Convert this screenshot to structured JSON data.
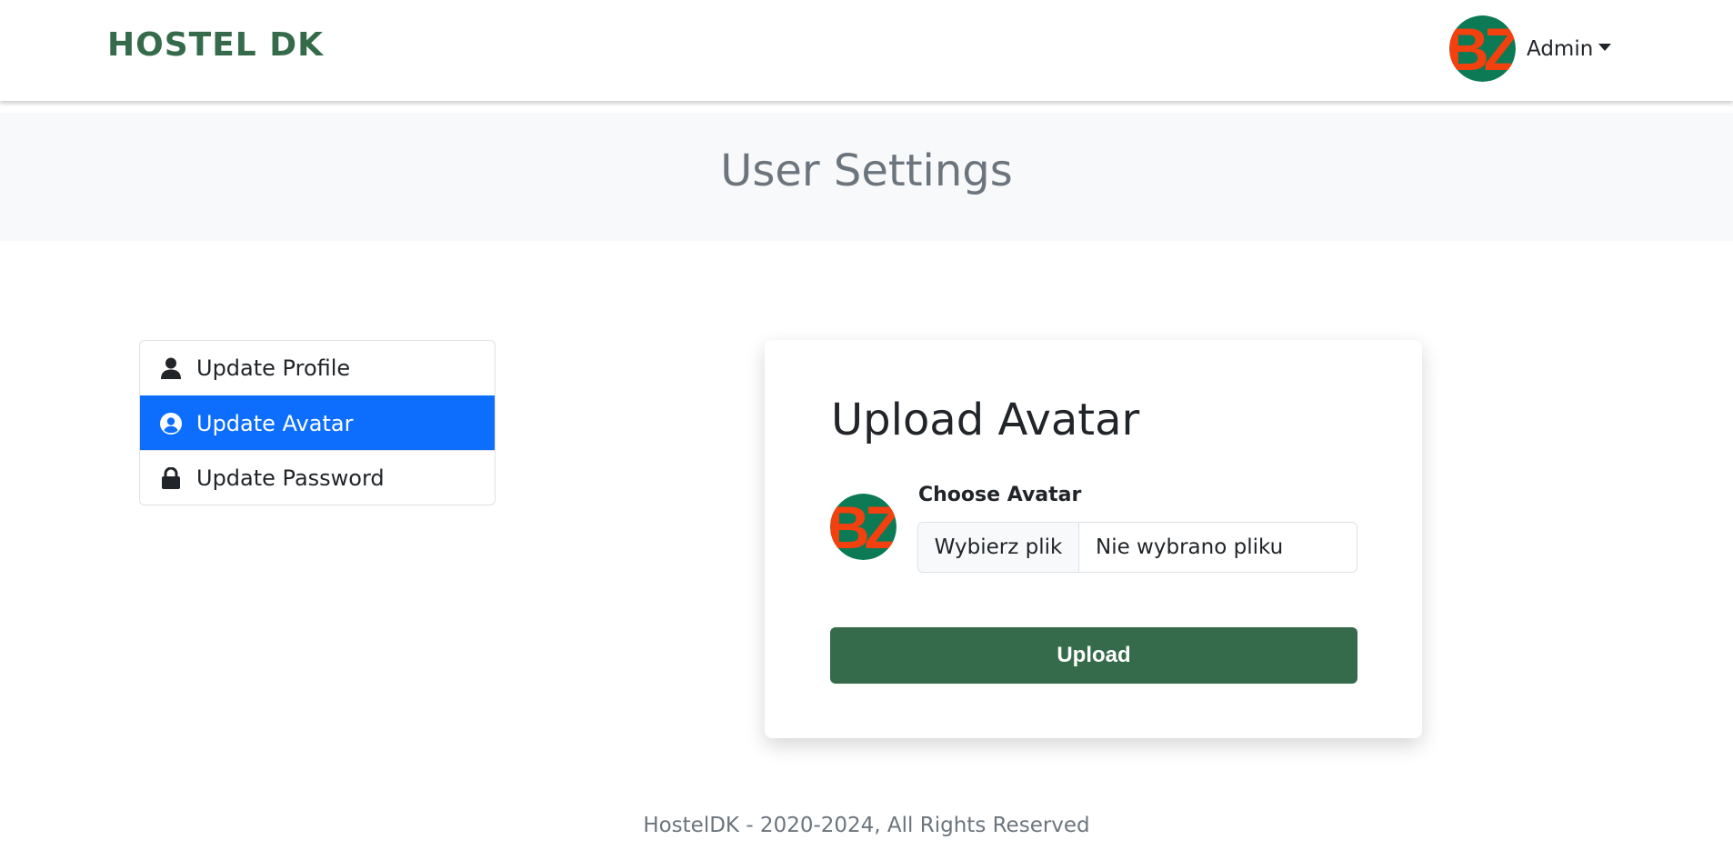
{
  "header": {
    "brand": "HOSTEL DK",
    "user_name": "Admin",
    "avatar_text": "BZ"
  },
  "page": {
    "title": "User Settings"
  },
  "sidebar": {
    "items": [
      {
        "label": "Update Profile",
        "icon": "user-icon",
        "active": false
      },
      {
        "label": "Update Avatar",
        "icon": "user-circle-icon",
        "active": true
      },
      {
        "label": "Update Password",
        "icon": "lock-icon",
        "active": false
      }
    ]
  },
  "card": {
    "title": "Upload Avatar",
    "field_label": "Choose Avatar",
    "file_button": "Wybierz plik",
    "file_status": "Nie wybrano pliku",
    "upload_label": "Upload",
    "avatar_text": "BZ"
  },
  "footer": {
    "text": "HostelDK - 2020-2024, All Rights Reserved"
  },
  "colors": {
    "brand": "#356b4a",
    "active": "#0d6efd",
    "avatar_bg": "#0b7a55",
    "avatar_text": "#f2400f",
    "muted": "#6c757d"
  }
}
